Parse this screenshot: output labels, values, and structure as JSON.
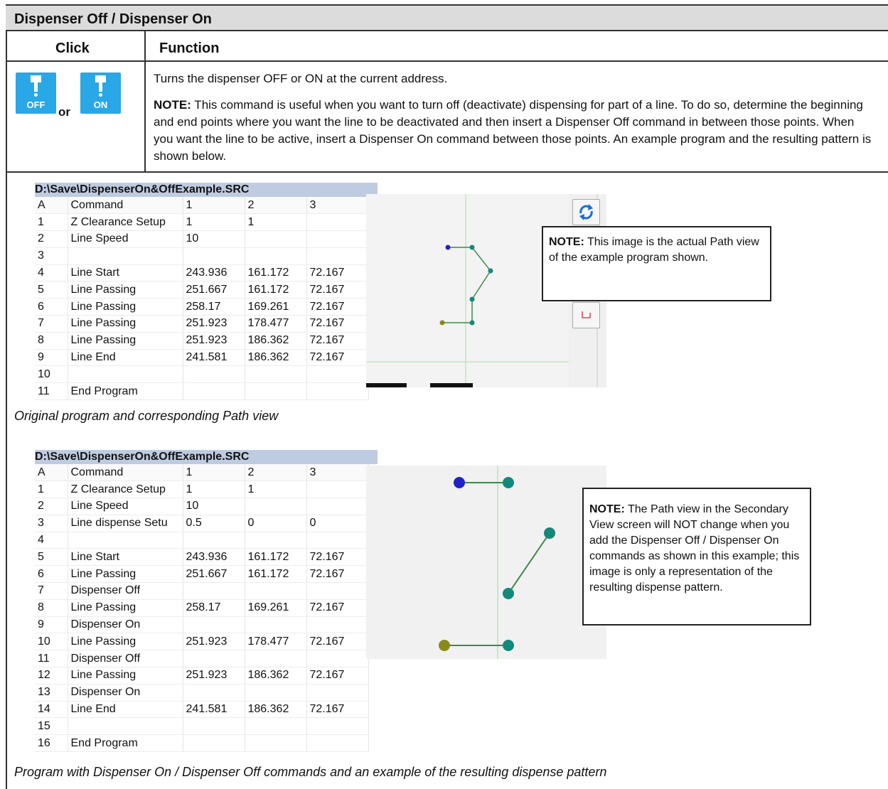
{
  "title": "Dispenser Off / Dispenser On",
  "headers": {
    "click": "Click",
    "function": "Function"
  },
  "icons": {
    "off_label": "OFF",
    "on_label": "ON",
    "or": "or"
  },
  "description": {
    "line1": "Turns the dispenser OFF or ON at the current address.",
    "note_label": "NOTE:",
    "note_text": " This command is useful when you want to turn off (deactivate) dispensing for part of a line. To do so, determine the beginning and end points where you want the line to be deactivated and then insert a Dispenser Off command in between those points. When you want the line to be active, insert a Dispenser On command between those points. An example program and the resulting pattern is shown below."
  },
  "program1": {
    "title": "D:\\Save\\DispenserOn&OffExample.SRC",
    "columns": [
      "A",
      "Command",
      "1",
      "2",
      "3"
    ],
    "rows": [
      [
        "1",
        "Z Clearance Setup",
        "1",
        "1",
        ""
      ],
      [
        "2",
        "Line Speed",
        "10",
        "",
        ""
      ],
      [
        "3",
        "",
        "",
        "",
        ""
      ],
      [
        "4",
        "Line Start",
        "243.936",
        "161.172",
        "72.167"
      ],
      [
        "5",
        "Line Passing",
        "251.667",
        "161.172",
        "72.167"
      ],
      [
        "6",
        "Line Passing",
        "258.17",
        "169.261",
        "72.167"
      ],
      [
        "7",
        "Line Passing",
        "251.923",
        "178.477",
        "72.167"
      ],
      [
        "8",
        "Line Passing",
        "251.923",
        "186.362",
        "72.167"
      ],
      [
        "9",
        "Line End",
        "241.581",
        "186.362",
        "72.167"
      ],
      [
        "10",
        "",
        "",
        "",
        ""
      ],
      [
        "11",
        "End Program",
        "",
        "",
        ""
      ]
    ]
  },
  "note1": {
    "label": "NOTE:",
    "text": " This image is the actual Path view of the example program shown."
  },
  "caption1": "Original program and corresponding Path view",
  "program2": {
    "title": "D:\\Save\\DispenserOn&OffExample.SRC",
    "columns": [
      "A",
      "Command",
      "1",
      "2",
      "3"
    ],
    "rows": [
      [
        "1",
        "Z Clearance Setup",
        "1",
        "1",
        ""
      ],
      [
        "2",
        "Line Speed",
        "10",
        "",
        ""
      ],
      [
        "3",
        "Line dispense Setu",
        "0.5",
        "0",
        "0"
      ],
      [
        "4",
        "",
        "",
        "",
        ""
      ],
      [
        "5",
        "Line Start",
        "243.936",
        "161.172",
        "72.167"
      ],
      [
        "6",
        "Line Passing",
        "251.667",
        "161.172",
        "72.167"
      ],
      [
        "7",
        "Dispenser Off",
        "",
        "",
        ""
      ],
      [
        "8",
        "Line Passing",
        "258.17",
        "169.261",
        "72.167"
      ],
      [
        "9",
        "Dispenser On",
        "",
        "",
        ""
      ],
      [
        "10",
        "Line Passing",
        "251.923",
        "178.477",
        "72.167"
      ],
      [
        "11",
        "Dispenser Off",
        "",
        "",
        ""
      ],
      [
        "12",
        "Line Passing",
        "251.923",
        "186.362",
        "72.167"
      ],
      [
        "13",
        "Dispenser On",
        "",
        "",
        ""
      ],
      [
        "14",
        "Line End",
        "241.581",
        "186.362",
        "72.167"
      ],
      [
        "15",
        "",
        "",
        "",
        ""
      ],
      [
        "16",
        "End Program",
        "",
        "",
        ""
      ]
    ]
  },
  "note2": {
    "label": "NOTE:",
    "text": " The Path view in the Secondary View screen will NOT change when you add the Dispenser Off / Dispenser On commands as shown in this example; this image is only a representation of the resulting dispense pattern."
  },
  "caption2": "Program with Dispenser On / Dispenser Off commands and an example of the resulting dispense pattern",
  "colors": {
    "start_point": "#1f23c7",
    "mid_point": "#13897a",
    "end_point": "#8a8a1a",
    "path_line": "#3f8a4d",
    "guide_line": "#7ce07c",
    "icon_blue": "#2aa7e6"
  },
  "icon_names": {
    "refresh": "refresh-icon",
    "side": "corner-icon"
  }
}
